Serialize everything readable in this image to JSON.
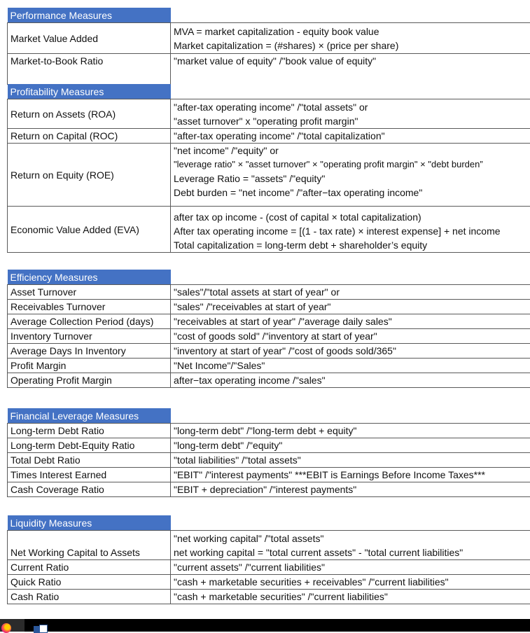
{
  "colors": {
    "header_bg": "#4472c4",
    "header_text": "#ffffff",
    "border": "#5a5a5a"
  },
  "sections": {
    "performance": {
      "title": "Performance Measures",
      "rows": [
        {
          "name": "Market Value Added",
          "lines": [
            "MVA = market capitalization - equity book value",
            "Market capitalization = (#shares) × (price per share)"
          ]
        },
        {
          "name": "Market-to-Book Ratio",
          "lines": [
            "\"market value of equity\" /\"book value of equity\"",
            ""
          ]
        }
      ]
    },
    "profitability": {
      "title": "Profitability Measures",
      "rows": [
        {
          "name": "Return on Assets (ROA)",
          "lines": [
            "\"after-tax operating income\" /\"total assets\" or",
            "\"asset turnover\" x \"operating profit margin\""
          ]
        },
        {
          "name": "Return on Capital (ROC)",
          "lines": [
            "\"after-tax operating income\" /\"total capitalization\""
          ]
        },
        {
          "name": "Return on Equity (ROE)",
          "lines": [
            "\"net income\" /\"equity\" or",
            "\"leverage ratio\" × \"asset turnover\" × \"operating profit margin\" × \"debt burden”",
            "Leverage Ratio = \"assets\" /\"equity\"",
            "Debt burden = \"net income\" /\"after−tax operating income\""
          ]
        },
        {
          "name": "Economic Value Added (EVA)",
          "lines": [
            "after tax op income - (cost of capital × total capitalization)",
            "After tax operating income = [(1 - tax rate) × interest expense] + net income",
            "Total capitalization = long-term debt + shareholder’s equity"
          ]
        }
      ]
    },
    "efficiency": {
      "title": "Efficiency Measures",
      "rows": [
        {
          "name": "Asset Turnover",
          "lines": [
            "\"sales\"/\"total assets at start of year\" or"
          ]
        },
        {
          "name": "Receivables Turnover",
          "lines": [
            "\"sales\" /\"receivables at start of year\""
          ]
        },
        {
          "name": "Average Collection Period (days)",
          "lines": [
            "\"receivables at start of year\" /\"average daily sales\""
          ]
        },
        {
          "name": "Inventory Turnover",
          "lines": [
            "\"cost of goods sold\" /\"inventory at start of year\""
          ]
        },
        {
          "name": "Average Days In Inventory",
          "lines": [
            "\"inventory at start of year\" /\"cost of goods sold/365\""
          ]
        },
        {
          "name": "Profit Margin",
          "lines": [
            "\"Net Income\"/\"Sales\""
          ]
        },
        {
          "name": "Operating Profit Margin",
          "lines": [
            "after−tax operating income /\"sales\""
          ]
        }
      ]
    },
    "leverage": {
      "title": "Financial Leverage Measures",
      "rows": [
        {
          "name": "Long-term Debt Ratio",
          "lines": [
            "\"long-term debt\" /\"long-term debt + equity\""
          ]
        },
        {
          "name": "Long-term Debt-Equity Ratio",
          "lines": [
            "\"long-term debt\" /\"equity\""
          ]
        },
        {
          "name": "Total Debt Ratio",
          "lines": [
            "\"total liabilities\" /\"total assets\""
          ]
        },
        {
          "name": "Times Interest Earned",
          "lines": [
            "\"EBIT\" /\"interest payments\" ***EBIT is Earnings Before Income Taxes***"
          ]
        },
        {
          "name": "Cash Coverage Ratio",
          "lines": [
            "\"EBIT + depreciation\" /\"interest payments\""
          ]
        }
      ]
    },
    "liquidity": {
      "title": "Liquidity Measures",
      "rows": [
        {
          "name": "Net Working Capital to Assets",
          "lines": [
            "\"net working capital\" /\"total assets\"",
            "net working capital = \"total current assets\" - \"total current liabilities\""
          ]
        },
        {
          "name": "Current Ratio",
          "lines": [
            "\"current assets\" /\"current liabilities\""
          ]
        },
        {
          "name": "Quick Ratio",
          "lines": [
            "\"cash + marketable securities + receivables\" /\"current liabilities\""
          ]
        },
        {
          "name": "Cash Ratio",
          "lines": [
            "\"cash + marketable securities\" /\"current liabilities\""
          ]
        }
      ]
    }
  },
  "taskbar": {
    "apps": [
      "firefox-icon",
      "word-icon"
    ]
  }
}
